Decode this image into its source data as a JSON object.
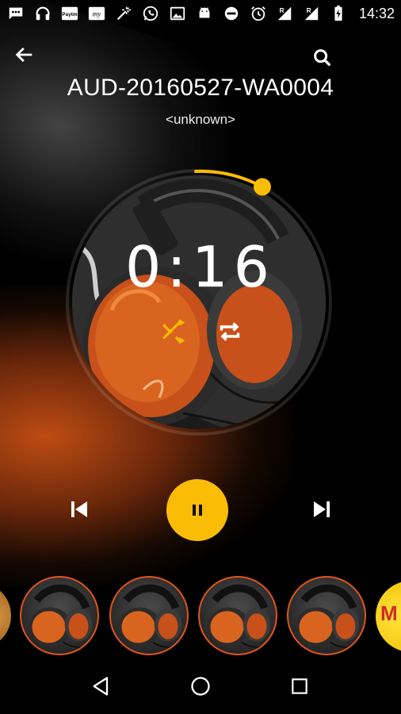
{
  "status_bar": {
    "time": "14:32",
    "left_icons": [
      "chat-bubble-icon",
      "headphones-icon",
      "paytm-icon",
      "my-app-icon",
      "magic-wand-icon",
      "whatsapp-icon",
      "image-icon",
      "android-icon",
      "do-not-disturb-icon",
      "alarm-icon"
    ],
    "right_icons": [
      "signal-icon",
      "signal-icon",
      "battery-charging-icon"
    ],
    "paytm_label": "Paytm",
    "my_label": "my"
  },
  "header": {
    "title": "AUD-20160527-WA0004",
    "artist": "<unknown>"
  },
  "player": {
    "elapsed": "0:16",
    "progress_fraction": 0.08,
    "shuffle_active": true,
    "repeat_active": false,
    "state": "playing"
  },
  "colors": {
    "accent": "#fbbc05",
    "thumb_border": "#e2541c"
  },
  "thumbnails": {
    "count_visible": 4,
    "edge_right_text": "M"
  },
  "nav": [
    "back",
    "home",
    "recents"
  ]
}
